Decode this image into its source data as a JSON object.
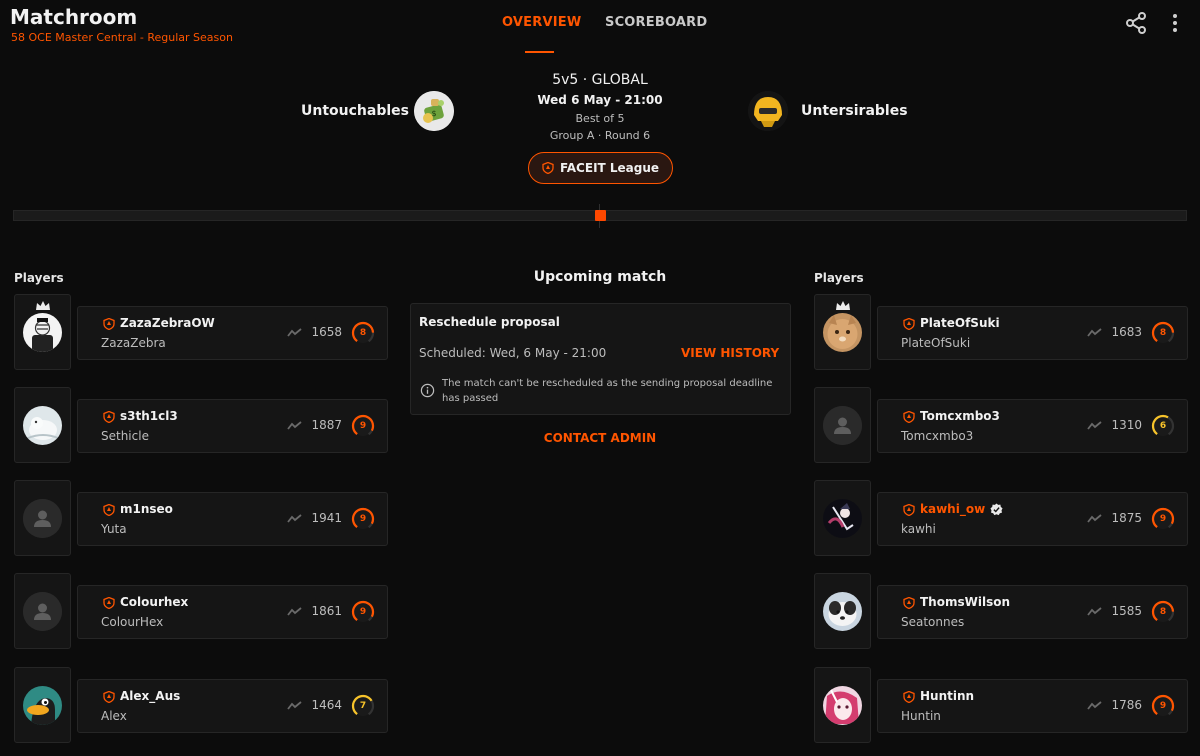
{
  "header": {
    "title": "Matchroom",
    "subtitle": "58 OCE Master Central - Regular Season",
    "tabs": [
      {
        "label": "OVERVIEW",
        "active": true
      },
      {
        "label": "SCOREBOARD",
        "active": false
      }
    ],
    "icons": [
      "share-icon",
      "more-vertical-icon"
    ]
  },
  "match": {
    "team1": {
      "name": "Untouchables",
      "logo": "money-bag-logo"
    },
    "team2": {
      "name": "Untersirables",
      "logo": "helmet-logo"
    },
    "mode": "5v5 · GLOBAL",
    "datetime": "Wed 6 May - 21:00",
    "format": "Best of 5",
    "group_round": "Group A · Round 6",
    "league_label": "FACEIT League",
    "progress": 0.5
  },
  "sections": {
    "players_left": "Players",
    "players_right": "Players",
    "upcoming": "Upcoming match"
  },
  "reschedule": {
    "title": "Reschedule proposal",
    "scheduled": "Scheduled: Wed, 6 May - 21:00",
    "view_history": "VIEW HISTORY",
    "note": "The match can't be rescheduled as the sending proposal deadline has passed",
    "contact_admin": "CONTACT ADMIN"
  },
  "colors": {
    "accent": "#ff5500",
    "background": "#0c0c0c",
    "card": "#151515",
    "level_orange": "#ff5500",
    "level_yellow": "#f7c32a"
  },
  "team1_players": [
    {
      "nickname": "ZazaZebraOW",
      "name": "ZazaZebra",
      "elo": "1658",
      "level": "8",
      "captain": true,
      "avatar": "zebra-avatar"
    },
    {
      "nickname": "s3th1cl3",
      "name": "Sethicle",
      "elo": "1887",
      "level": "9",
      "captain": false,
      "avatar": "white-creature-avatar"
    },
    {
      "nickname": "m1nseo",
      "name": "Yuta",
      "elo": "1941",
      "level": "9",
      "captain": false,
      "avatar": "default-avatar"
    },
    {
      "nickname": "Colourhex",
      "name": "ColourHex",
      "elo": "1861",
      "level": "9",
      "captain": false,
      "avatar": "default-avatar"
    },
    {
      "nickname": "Alex_Aus",
      "name": "Alex",
      "elo": "1464",
      "level": "7",
      "captain": false,
      "avatar": "duck-avatar"
    }
  ],
  "team2_players": [
    {
      "nickname": "PlateOfSuki",
      "name": "PlateOfSuki",
      "elo": "1683",
      "level": "8",
      "captain": true,
      "avatar": "cat-avatar"
    },
    {
      "nickname": "Tomcxmbo3",
      "name": "Tomcxmbo3",
      "elo": "1310",
      "level": "6",
      "captain": false,
      "avatar": "default-avatar"
    },
    {
      "nickname": "kawhi_ow",
      "name": "kawhi",
      "elo": "1875",
      "level": "9",
      "captain": false,
      "avatar": "anime-avatar",
      "verified": true,
      "highlight": true
    },
    {
      "nickname": "ThomsWilson",
      "name": "Seatonnes",
      "elo": "1585",
      "level": "8",
      "captain": false,
      "avatar": "dog-avatar"
    },
    {
      "nickname": "Huntinn",
      "name": "Huntin",
      "elo": "1786",
      "level": "9",
      "captain": false,
      "avatar": "pink-anime-avatar"
    }
  ]
}
